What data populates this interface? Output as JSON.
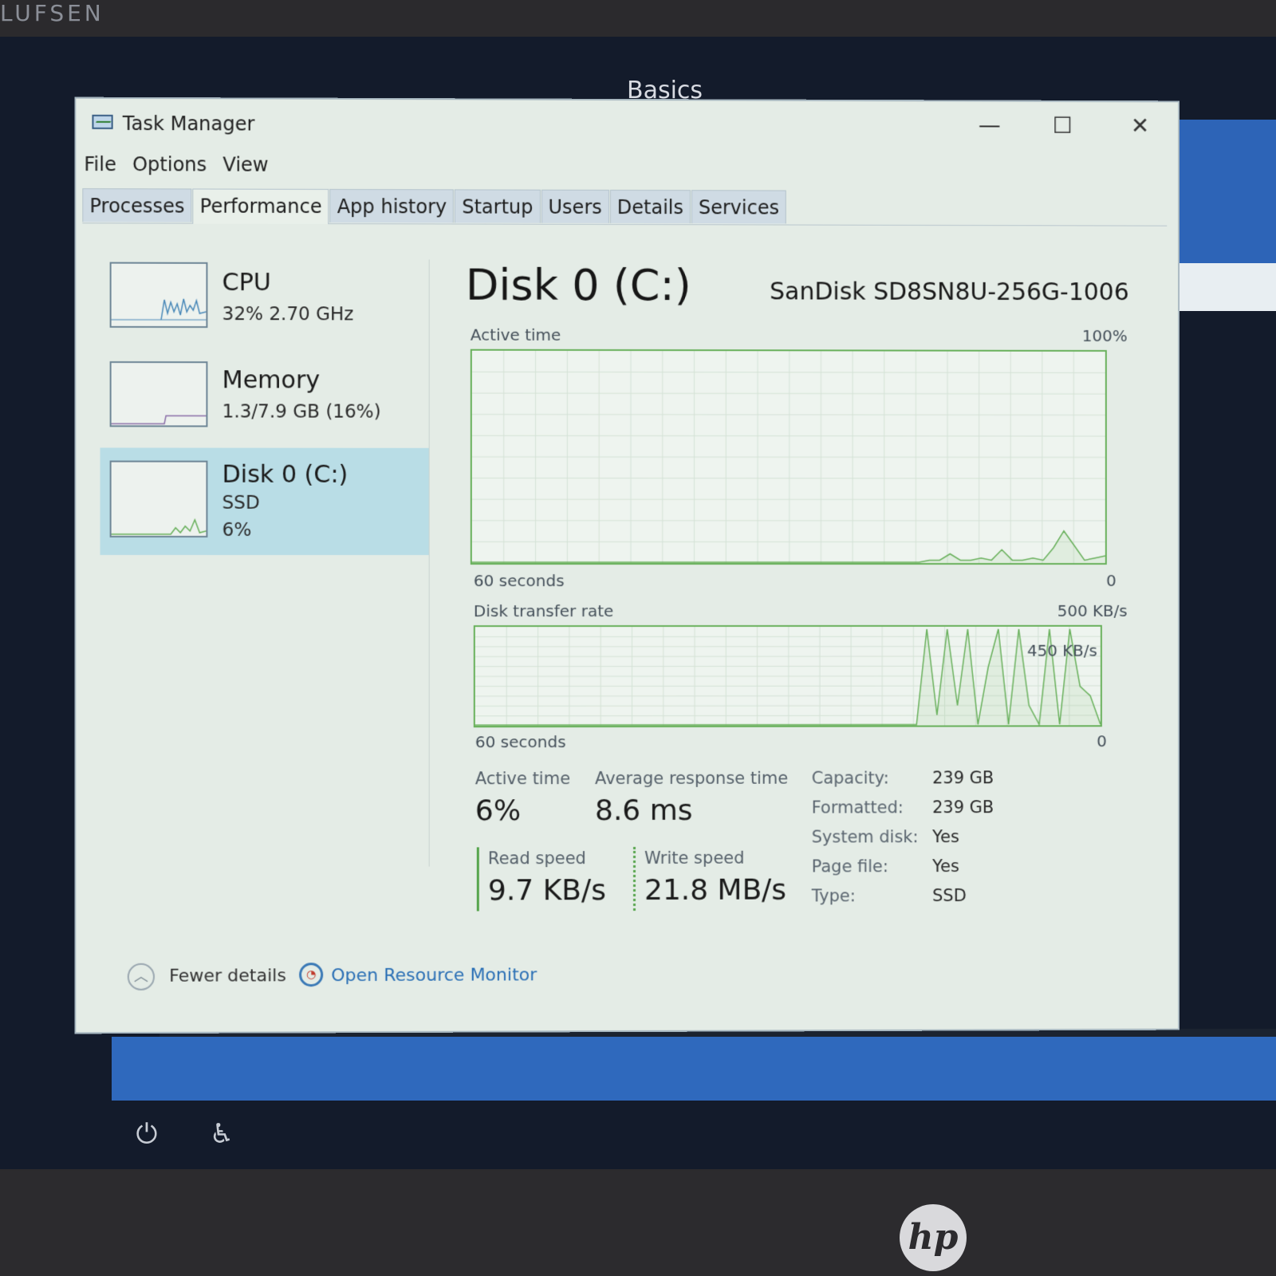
{
  "bezel": {
    "brand_text": "LUFSEN"
  },
  "desktop": {
    "window_caption": "Basics"
  },
  "window": {
    "title": "Task Manager",
    "controls": {
      "minimize": "—",
      "maximize": "☐",
      "close": "✕"
    }
  },
  "menu": [
    "File",
    "Options",
    "View"
  ],
  "tabs": [
    {
      "label": "Processes",
      "active": false
    },
    {
      "label": "Performance",
      "active": true
    },
    {
      "label": "App history",
      "active": false
    },
    {
      "label": "Startup",
      "active": false
    },
    {
      "label": "Users",
      "active": false
    },
    {
      "label": "Details",
      "active": false
    },
    {
      "label": "Services",
      "active": false
    }
  ],
  "sidebar": {
    "cpu": {
      "name": "CPU",
      "detail": "32%  2.70 GHz"
    },
    "memory": {
      "name": "Memory",
      "detail": "1.3/7.9 GB (16%)"
    },
    "disk": {
      "name": "Disk 0 (C:)",
      "type": "SSD",
      "usage": "6%"
    }
  },
  "main": {
    "title": "Disk 0 (C:)",
    "model": "SanDisk SD8SN8U-256G-1006",
    "active_graph": {
      "label": "Active time",
      "max_label": "100%",
      "time_label": "60 seconds",
      "zero_label": "0",
      "values": [
        0,
        0,
        0,
        0,
        0,
        0,
        0,
        0,
        0,
        0,
        0,
        0,
        0,
        0,
        0,
        0,
        0,
        0,
        0,
        0,
        0,
        0,
        0,
        0,
        0,
        0,
        0,
        0,
        0,
        0,
        0,
        0,
        0,
        0,
        0,
        0,
        0,
        0,
        0,
        0,
        0,
        0,
        0,
        0,
        1,
        1,
        4,
        1,
        1,
        2,
        1,
        6,
        1,
        1,
        2,
        1,
        7,
        15,
        8,
        1,
        2,
        3
      ]
    },
    "transfer_graph": {
      "label": "Disk transfer rate",
      "max_label": "500 KB/s",
      "inner_label": "450 KB/s",
      "time_label": "60 seconds",
      "zero_label": "0",
      "values": [
        0,
        0,
        0,
        0,
        0,
        0,
        0,
        0,
        0,
        0,
        0,
        0,
        0,
        0,
        0,
        0,
        0,
        0,
        0,
        0,
        0,
        0,
        0,
        0,
        0,
        0,
        0,
        0,
        0,
        0,
        0,
        0,
        0,
        0,
        0,
        0,
        0,
        0,
        0,
        0,
        0,
        0,
        0,
        0,
        100,
        10,
        100,
        20,
        100,
        0,
        60,
        100,
        0,
        100,
        20,
        0,
        100,
        0,
        100,
        40,
        30,
        0
      ]
    },
    "stats": {
      "active_time_label": "Active time",
      "active_time_value": "6%",
      "avg_response_label": "Average response time",
      "avg_response_value": "8.6 ms",
      "read_label": "Read speed",
      "read_value": "9.7 KB/s",
      "write_label": "Write speed",
      "write_value": "21.8 MB/s"
    },
    "properties": [
      {
        "key": "Capacity:",
        "value": "239 GB"
      },
      {
        "key": "Formatted:",
        "value": "239 GB"
      },
      {
        "key": "System disk:",
        "value": "Yes"
      },
      {
        "key": "Page file:",
        "value": "Yes"
      },
      {
        "key": "Type:",
        "value": "SSD"
      }
    ]
  },
  "footer": {
    "fewer_details": "Fewer details",
    "open_resource_monitor": "Open Resource Monitor"
  },
  "colors": {
    "graph_line": "#68b05b",
    "graph_grid": "#d4e2d6",
    "selected_item": "#b9dde6",
    "link": "#2a6fb5"
  },
  "icons": {
    "app": "task-manager-icon",
    "fewer": "chevron-up-icon",
    "monitor": "resource-monitor-icon",
    "taskbar_power": "power-icon",
    "taskbar_accessibility": "accessibility-icon"
  }
}
